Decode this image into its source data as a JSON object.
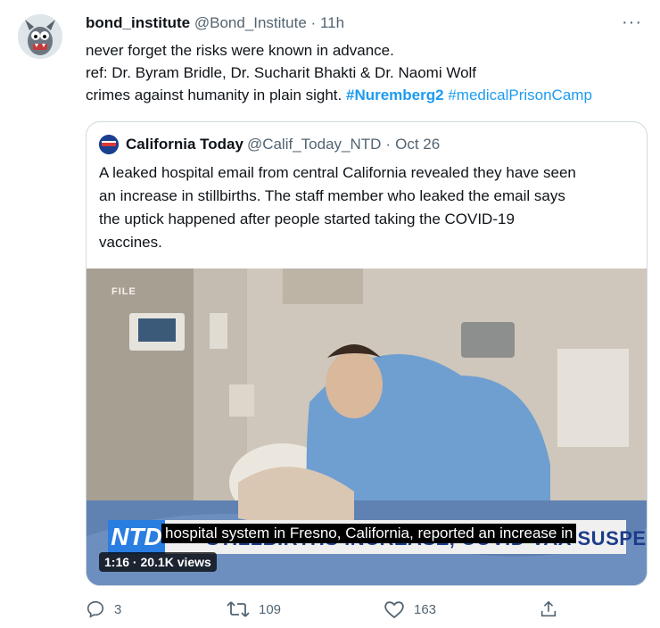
{
  "tweet": {
    "display_name": "bond_institute",
    "handle": "@Bond_Institute",
    "separator": "·",
    "time": "11h",
    "more_label": "···",
    "lines": [
      "never forget the risks were known in advance.",
      "ref: Dr. Byram Bridle, Dr. Sucharit Bhakti & Dr. Naomi Wolf"
    ],
    "line3_text": "crimes against humanity in plain sight.",
    "hashtags": [
      "#Nuremberg2",
      "#medicalPrisonCamp"
    ]
  },
  "quote": {
    "display_name": "California Today",
    "handle": "@Calif_Today_NTD",
    "separator": "·",
    "date": "Oct 26",
    "lines": [
      "A leaked hospital email from central California revealed they have seen",
      "an increase in stillbirths. The staff member who leaked the email says",
      "the uptick happened after people started taking the COVID-19",
      "vaccines."
    ],
    "media": {
      "file_label": "FILE",
      "ntd_label": "NTD",
      "lower_third": "STILLBIRTHS INCREASE, COVID VAX SUSPECTED",
      "subtitle": "hospital system in Fresno, California, reported an increase in",
      "views": "1:16 · 20.1K views"
    }
  },
  "actions": {
    "replies": "3",
    "retweets": "109",
    "likes": "163"
  },
  "colors": {
    "link": "#1d9bf0",
    "secondary_text": "#536471",
    "border": "#cfd9de"
  },
  "icons": [
    "monster-avatar-icon",
    "ntd-logo-icon",
    "reply-icon",
    "retweet-icon",
    "like-icon",
    "share-icon",
    "more-icon"
  ]
}
